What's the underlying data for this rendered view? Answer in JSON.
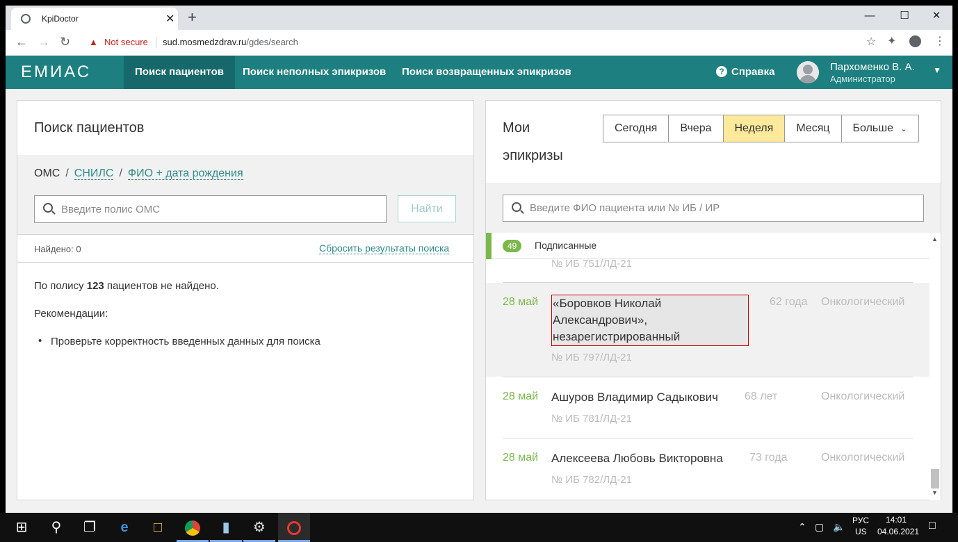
{
  "browser": {
    "tab_title": "KpiDoctor",
    "tab_close": "✕",
    "new_tab": "+",
    "win_min": "—",
    "win_max": "☐",
    "win_close": "✕",
    "security_text": "Not secure",
    "url_host": "sud.mosmedzdrav.ru",
    "url_path": "/gdes/search"
  },
  "header": {
    "logo": "ЕМИАС",
    "nav": [
      {
        "label": "Поиск пациентов",
        "active": true
      },
      {
        "label": "Поиск неполных эпикризов",
        "active": false
      },
      {
        "label": "Поиск возвращенных эпикризов",
        "active": false
      }
    ],
    "help_label": "Справка",
    "user_name": "Пархоменко В. А.",
    "user_role": "Администратор"
  },
  "left_panel": {
    "title": "Поиск пациентов",
    "crumb_current": "ОМС",
    "crumb_sep": "/",
    "crumb_link1": "СНИЛС",
    "crumb_link2": "ФИО + дата рождения",
    "input_placeholder": "Введите полис ОМС",
    "find_button": "Найти",
    "found_text": "Найдено: 0",
    "reset_link": "Сбросить результаты поиска",
    "msg_prefix": "По полису ",
    "msg_policy": "123",
    "msg_suffix": " пациентов не найдено.",
    "recommendations_title": "Рекомендации:",
    "recommendation_1": "Проверьте корректность введенных данных для поиска"
  },
  "right_panel": {
    "title_line1": "Мои",
    "title_line2": "эпикризы",
    "periods": [
      {
        "label": "Сегодня",
        "active": false
      },
      {
        "label": "Вчера",
        "active": false
      },
      {
        "label": "Неделя",
        "active": true
      },
      {
        "label": "Месяц",
        "active": false
      },
      {
        "label": "Больше",
        "active": false
      }
    ],
    "search_placeholder": "Введите ФИО пациента или № ИБ / ИР",
    "group_count": "49",
    "group_label": "Подписанные",
    "partial_ib": "№ ИБ 751/ЛД-21",
    "rows": [
      {
        "date": "28 май",
        "name": "«Боровков Николай Александрович», незарегистрированный",
        "age": "62 года",
        "dept": "Онкологический",
        "ib": "№ ИБ 797/ЛД-21"
      },
      {
        "date": "28 май",
        "name": "Ашуров Владимир Садыкович",
        "age": "68 лет",
        "dept": "Онкологический",
        "ib": "№ ИБ 781/ЛД-21"
      },
      {
        "date": "28 май",
        "name": "Алексеева Любовь Викторовна",
        "age": "73 года",
        "dept": "Онкологический",
        "ib": "№ ИБ 782/ЛД-21"
      }
    ]
  },
  "taskbar": {
    "lang": "РУС",
    "layout": "US",
    "time": "14:01",
    "date": "04.06.2021"
  }
}
